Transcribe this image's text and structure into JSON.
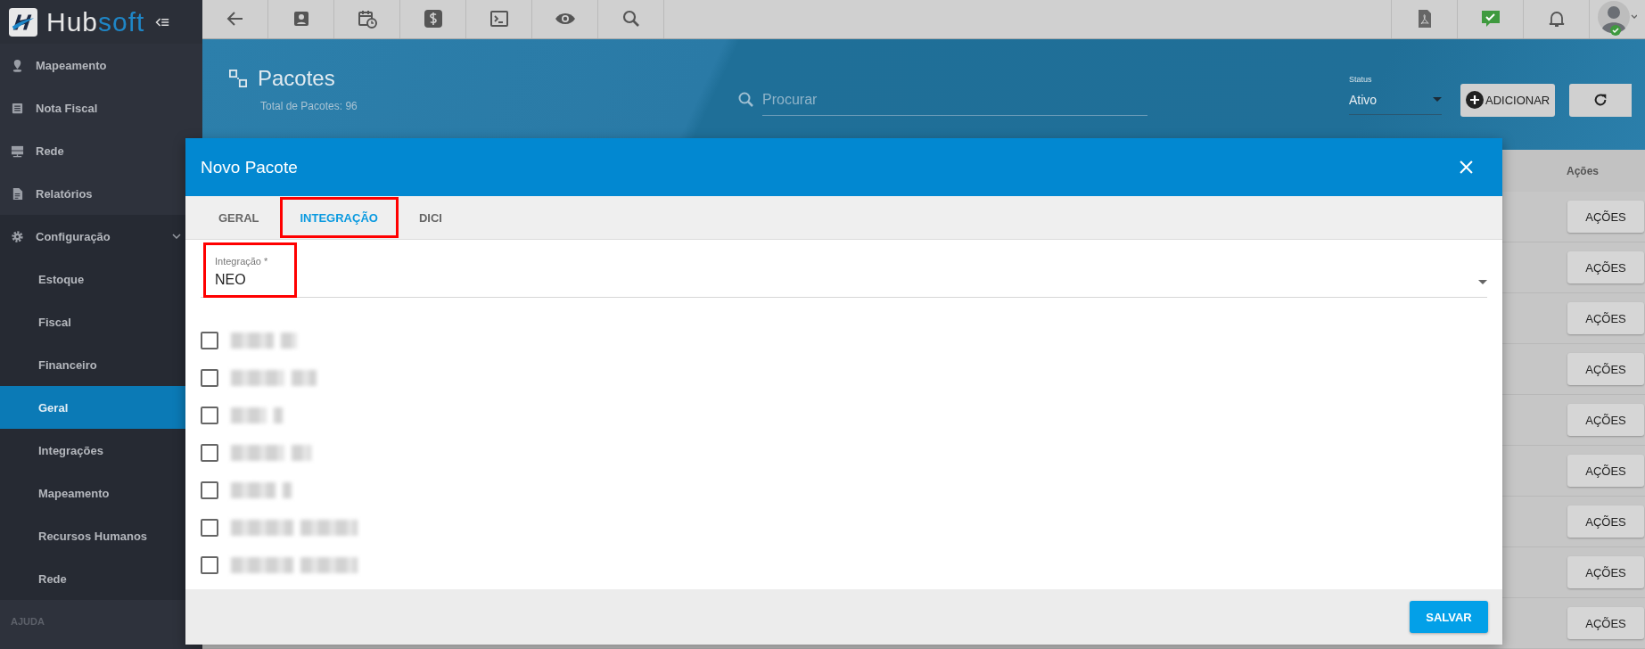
{
  "sidebar": {
    "brand": [
      "Hub",
      "soft"
    ],
    "items": [
      {
        "label": "Mapeamento"
      },
      {
        "label": "Nota Fiscal"
      },
      {
        "label": "Rede"
      },
      {
        "label": "Relatórios"
      },
      {
        "label": "Configuração",
        "expanded": true,
        "children": [
          {
            "label": "Estoque",
            "selected": false
          },
          {
            "label": "Fiscal",
            "selected": false
          },
          {
            "label": "Financeiro",
            "selected": false
          },
          {
            "label": "Geral",
            "selected": true
          },
          {
            "label": "Integrações",
            "selected": false
          },
          {
            "label": "Mapeamento",
            "selected": false
          },
          {
            "label": "Recursos Humanos",
            "selected": false
          },
          {
            "label": "Rede",
            "selected": false
          }
        ]
      }
    ],
    "section": "AJUDA"
  },
  "page": {
    "title": "Pacotes",
    "subtitle": "Total de Pacotes: 96",
    "search": {
      "placeholder": "Procurar"
    },
    "status": {
      "label": "Status",
      "value": "Ativo"
    },
    "add_button": "ADICIONAR"
  },
  "table": {
    "columns": [
      "Ações"
    ],
    "rows": [
      {
        "action": "AÇÕES"
      },
      {
        "action": "AÇÕES"
      },
      {
        "action": "AÇÕES"
      },
      {
        "action": "AÇÕES"
      },
      {
        "action": "AÇÕES"
      },
      {
        "action": "AÇÕES"
      },
      {
        "action": "AÇÕES"
      },
      {
        "action": "AÇÕES"
      },
      {
        "action": "AÇÕES"
      }
    ]
  },
  "modal": {
    "title": "Novo Pacote",
    "tabs": [
      {
        "label": "GERAL",
        "selected": false,
        "highlighted": false
      },
      {
        "label": "INTEGRAÇÃO",
        "selected": true,
        "highlighted": true
      },
      {
        "label": "DICI",
        "selected": false,
        "highlighted": false
      }
    ],
    "field": {
      "label": "Integração *",
      "value": "NEO",
      "highlighted": true
    },
    "options": [
      {
        "checked": false
      },
      {
        "checked": false
      },
      {
        "checked": false
      },
      {
        "checked": false
      },
      {
        "checked": false
      },
      {
        "checked": false
      },
      {
        "checked": false
      }
    ],
    "save_button": "SALVAR"
  }
}
